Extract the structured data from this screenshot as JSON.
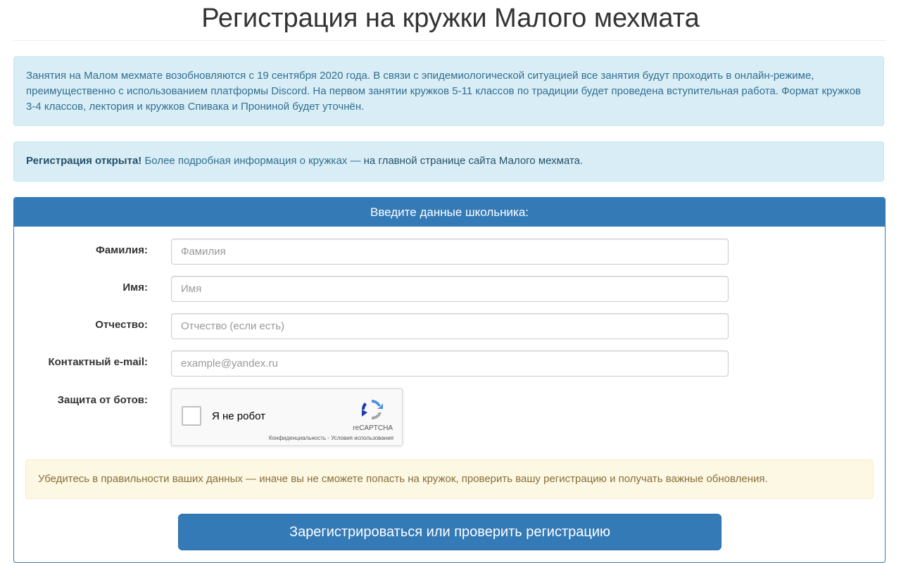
{
  "page": {
    "title": "Регистрация на кружки Малого мехмата"
  },
  "notice": {
    "text": "Занятия на Малом мехмате возобновляются с 19 сентября 2020 года. В связи с эпидемиологической ситуацией все занятия будут проходить в онлайн-режиме, преимущественно с использованием платформы Discord. На первом занятии кружков 5-11 классов по традиции будет проведена вступительная работа. Формат кружков 3-4 классов, лектория и кружков Спивака и Прониной будет уточнён."
  },
  "registration_notice": {
    "bold": "Регистрация открыта!",
    "text": " Более подробная информация о кружках — ",
    "link": "на главной странице сайта Малого мехмата",
    "end": "."
  },
  "form": {
    "heading": "Введите данные школьника:",
    "fields": [
      {
        "label": "Фамилия:",
        "placeholder": "Фамилия",
        "value": ""
      },
      {
        "label": "Имя:",
        "placeholder": "Имя",
        "value": ""
      },
      {
        "label": "Отчество:",
        "placeholder": "Отчество (если есть)",
        "value": ""
      },
      {
        "label": "Контактный e-mail:",
        "placeholder": "example@yandex.ru",
        "value": ""
      }
    ],
    "captcha": {
      "label": "Защита от ботов:",
      "checkbox_label": "Я не робот",
      "brand": "reCAPTCHA",
      "terms": "Конфиденциальность - Условия использования",
      "checked": false
    },
    "warning": "Убедитесь в правильности ваших данных — иначе вы не сможете попасть на кружок, проверить вашу регистрацию и получать важные обновления.",
    "submit_label": "Зарегистрироваться или проверить регистрацию"
  },
  "colors": {
    "primary": "#337ab7",
    "info_bg": "#d9edf7",
    "info_text": "#31708f",
    "warning_bg": "#fcf8e3",
    "warning_text": "#8a6d3b"
  },
  "icons": {
    "captcha_logo": "recaptcha-logo-icon"
  }
}
